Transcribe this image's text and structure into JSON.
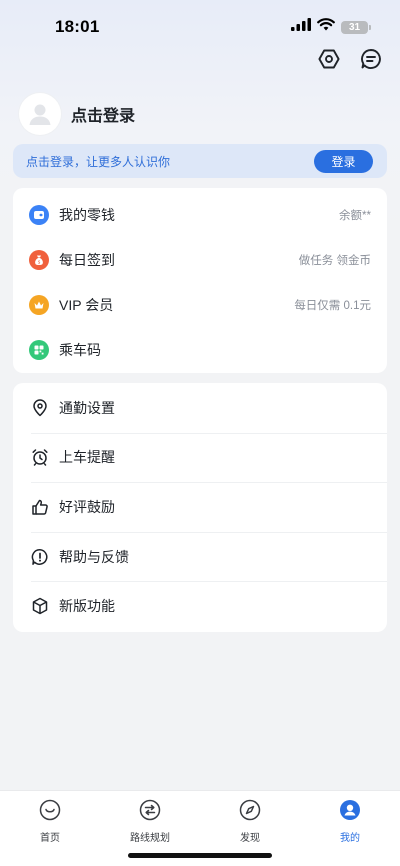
{
  "status_bar": {
    "time": "18:01",
    "battery": "31"
  },
  "profile": {
    "login_title": "点击登录"
  },
  "login_banner": {
    "text": "点击登录，让更多人认识你",
    "button": "登录"
  },
  "account_items": [
    {
      "label": "我的零钱",
      "right": "余额**",
      "color": "#3b82f6",
      "icon": "wallet-icon"
    },
    {
      "label": "每日签到",
      "right": "做任务 领金币",
      "color": "#f0603c",
      "icon": "money-bag-icon"
    },
    {
      "label": "VIP 会员",
      "right": "每日仅需 0.1元",
      "color": "#f5a524",
      "icon": "crown-icon"
    },
    {
      "label": "乘车码",
      "right": "",
      "color": "#34c87a",
      "icon": "qrcode-icon"
    }
  ],
  "settings_items": [
    {
      "label": "通勤设置",
      "icon": "location-pin-icon"
    },
    {
      "label": "上车提醒",
      "icon": "alarm-clock-icon"
    },
    {
      "label": "好评鼓励",
      "icon": "thumbs-up-icon"
    },
    {
      "label": "帮助与反馈",
      "icon": "help-icon"
    },
    {
      "label": "新版功能",
      "icon": "cube-icon"
    }
  ],
  "tabs": [
    {
      "label": "首页",
      "active": false
    },
    {
      "label": "路线规划",
      "active": false
    },
    {
      "label": "发现",
      "active": false
    },
    {
      "label": "我的",
      "active": true
    }
  ],
  "colors": {
    "accent": "#2a6fe0",
    "banner_bg": "#dde7f8"
  }
}
